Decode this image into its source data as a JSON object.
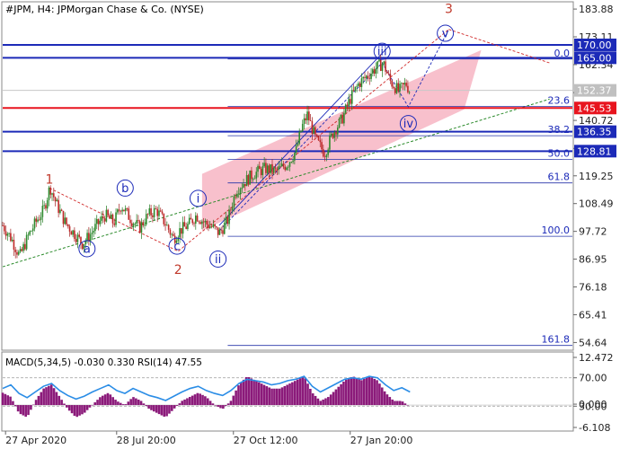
{
  "chart_data": {
    "type": "candlestick",
    "title": "#JPM, H4:  JPMorgan Chase & Co. (NYSE)",
    "price_axis": {
      "ticks": [
        "183.88",
        "173.11",
        "162.34",
        "151.49",
        "140.72",
        "129.87",
        "119.25",
        "108.49",
        "97.72",
        "86.95",
        "76.18",
        "65.41",
        "54.64"
      ],
      "ylim": [
        52,
        186
      ]
    },
    "time_axis": {
      "labels": [
        "27 Apr 2020",
        "28 Jul 20:00",
        "27 Oct 12:00",
        "27 Jan 20:00"
      ],
      "xlim": [
        0,
        100
      ]
    },
    "price_lines": [
      {
        "value": 170.0,
        "label": "170.00",
        "color": "#1c2ab8",
        "kind": "level"
      },
      {
        "value": 165.0,
        "label": "165.00",
        "color": "#1c2ab8",
        "kind": "level"
      },
      {
        "value": 152.37,
        "label": "152.37",
        "color": "#c8c8c8",
        "kind": "current"
      },
      {
        "value": 145.53,
        "label": "145.53",
        "color": "#e8141e",
        "kind": "level"
      },
      {
        "value": 136.35,
        "label": "136.35",
        "color": "#1c2ab8",
        "kind": "level"
      },
      {
        "value": 128.81,
        "label": "128.81",
        "color": "#1c2ab8",
        "kind": "level"
      }
    ],
    "fibonacci": [
      {
        "level": "0.0",
        "price": 164.5
      },
      {
        "level": "23.6",
        "price": 146.2
      },
      {
        "level": "38.2",
        "price": 134.8
      },
      {
        "level": "50.0",
        "price": 125.6
      },
      {
        "level": "61.8",
        "price": 116.5
      },
      {
        "level": "100.0",
        "price": 95.8
      },
      {
        "level": "161.8",
        "price": 53.5
      }
    ],
    "wave_labels": [
      {
        "text": "1",
        "t": 8.2,
        "price": 118,
        "style": "plain"
      },
      {
        "text": "2",
        "t": 30.8,
        "price": 83,
        "style": "plain"
      },
      {
        "text": "3",
        "t": 78.3,
        "price": 184,
        "style": "plain"
      },
      {
        "text": "a",
        "t": 14.8,
        "price": 91,
        "style": "circle"
      },
      {
        "text": "b",
        "t": 21.5,
        "price": 114.5,
        "style": "circle"
      },
      {
        "text": "c",
        "t": 30.6,
        "price": 92,
        "style": "circle"
      },
      {
        "text": "i",
        "t": 34.3,
        "price": 110.5,
        "style": "circle"
      },
      {
        "text": "ii",
        "t": 37.8,
        "price": 87,
        "style": "circle"
      },
      {
        "text": "iii",
        "t": 66.6,
        "price": 167.5,
        "style": "circle"
      },
      {
        "text": "iv",
        "t": 71.2,
        "price": 139.5,
        "style": "circle"
      },
      {
        "text": "v",
        "t": 77.7,
        "price": 174.5,
        "style": "circle"
      }
    ],
    "prices": [
      [
        0,
        100
      ],
      [
        1.5,
        95
      ],
      [
        3,
        88
      ],
      [
        4.5,
        96
      ],
      [
        6,
        102
      ],
      [
        7.2,
        106
      ],
      [
        8.3,
        115
      ],
      [
        9.5,
        108
      ],
      [
        11,
        101
      ],
      [
        12.5,
        97
      ],
      [
        14,
        93
      ],
      [
        15.2,
        96
      ],
      [
        16.5,
        100
      ],
      [
        18,
        104
      ],
      [
        19.5,
        101
      ],
      [
        20.8,
        108
      ],
      [
        22.3,
        103
      ],
      [
        24,
        99
      ],
      [
        25.5,
        104
      ],
      [
        27,
        106
      ],
      [
        28.5,
        101
      ],
      [
        30,
        95
      ],
      [
        31,
        98
      ],
      [
        32.5,
        100
      ],
      [
        34,
        104
      ],
      [
        35.5,
        101
      ],
      [
        37,
        99
      ],
      [
        38,
        97
      ],
      [
        39.5,
        102
      ],
      [
        41,
        114
      ],
      [
        42.5,
        117
      ],
      [
        44,
        120
      ],
      [
        46,
        122
      ],
      [
        48,
        121
      ],
      [
        50,
        124
      ],
      [
        51.5,
        129
      ],
      [
        52.5,
        138
      ],
      [
        53.5,
        143
      ],
      [
        55,
        133
      ],
      [
        56.5,
        128
      ],
      [
        58,
        136
      ],
      [
        59.5,
        141
      ],
      [
        61,
        149
      ],
      [
        62.5,
        155
      ],
      [
        64,
        158
      ],
      [
        65.5,
        161
      ],
      [
        66.8,
        163
      ],
      [
        68,
        156
      ],
      [
        69.5,
        152
      ],
      [
        70.8,
        155
      ],
      [
        71.5,
        152
      ]
    ]
  },
  "indicator": {
    "title": "MACD(5,34,5) -0.030 0.330 RSI(14) 47.55",
    "ticks": [
      "12.472",
      "70.00",
      "0.000",
      "30.00",
      "-6.108"
    ],
    "rsi": [
      55,
      60,
      48,
      42,
      50,
      58,
      62,
      52,
      45,
      40,
      44,
      50,
      55,
      60,
      52,
      48,
      55,
      50,
      45,
      42,
      38,
      44,
      50,
      55,
      58,
      52,
      48,
      45,
      52,
      62,
      68,
      66,
      64,
      60,
      62,
      66,
      68,
      72,
      58,
      50,
      56,
      62,
      68,
      70,
      68,
      72,
      70,
      60,
      52,
      56,
      50
    ],
    "macd": [
      3,
      2,
      -2,
      -3,
      1,
      4,
      5,
      2,
      -1,
      -3,
      -2,
      0,
      2,
      3,
      1,
      0,
      2,
      1,
      -1,
      -2,
      -3,
      -1,
      1,
      2,
      3,
      2,
      0,
      -1,
      1,
      5,
      7,
      6,
      5,
      4,
      4,
      5,
      6,
      7,
      3,
      1,
      2,
      4,
      6,
      7,
      6,
      7,
      6,
      3,
      1,
      1,
      -0.5
    ]
  }
}
